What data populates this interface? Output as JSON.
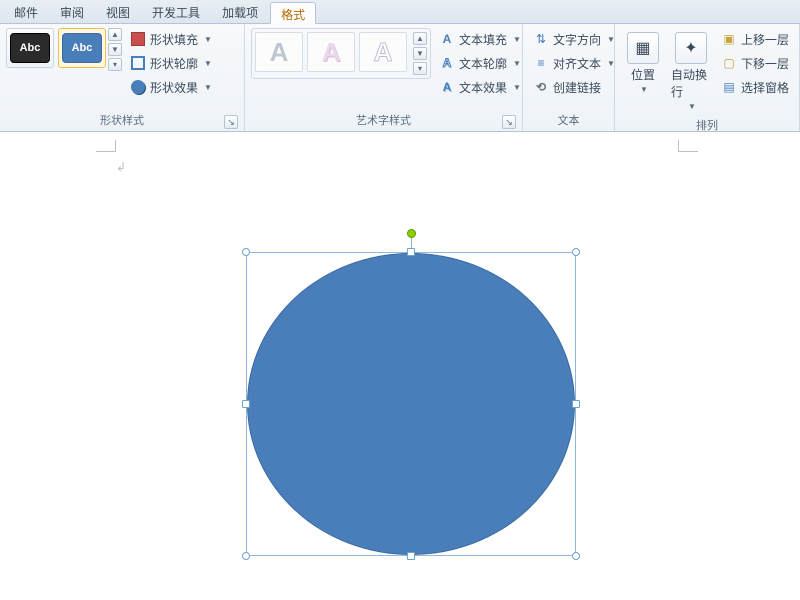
{
  "tabs": {
    "items": [
      {
        "label": "邮件"
      },
      {
        "label": "审阅"
      },
      {
        "label": "视图"
      },
      {
        "label": "开发工具"
      },
      {
        "label": "加载项"
      },
      {
        "label": "格式"
      }
    ],
    "active_index": 5
  },
  "ribbon": {
    "shape_styles": {
      "label": "形状样式",
      "swatch_text": "Abc",
      "fill": "形状填充",
      "outline": "形状轮廓",
      "effects": "形状效果"
    },
    "wordart": {
      "label": "艺术字样式",
      "glyph": "A",
      "text_fill": "文本填充",
      "text_outline": "文本轮廓",
      "text_effects": "文本效果"
    },
    "text": {
      "label": "文本",
      "direction": "文字方向",
      "align": "对齐文本",
      "link": "创建链接"
    },
    "arrange": {
      "label": "排列",
      "position": "位置",
      "wrap": "自动换行",
      "bring_forward": "上移一层",
      "send_backward": "下移一层",
      "selection_pane": "选择窗格"
    }
  },
  "canvas": {
    "paragraph_mark": "↲",
    "shape": {
      "type": "ellipse",
      "fill": "#4a7ebb",
      "outline": "#3a6aa0",
      "selected": true
    }
  }
}
